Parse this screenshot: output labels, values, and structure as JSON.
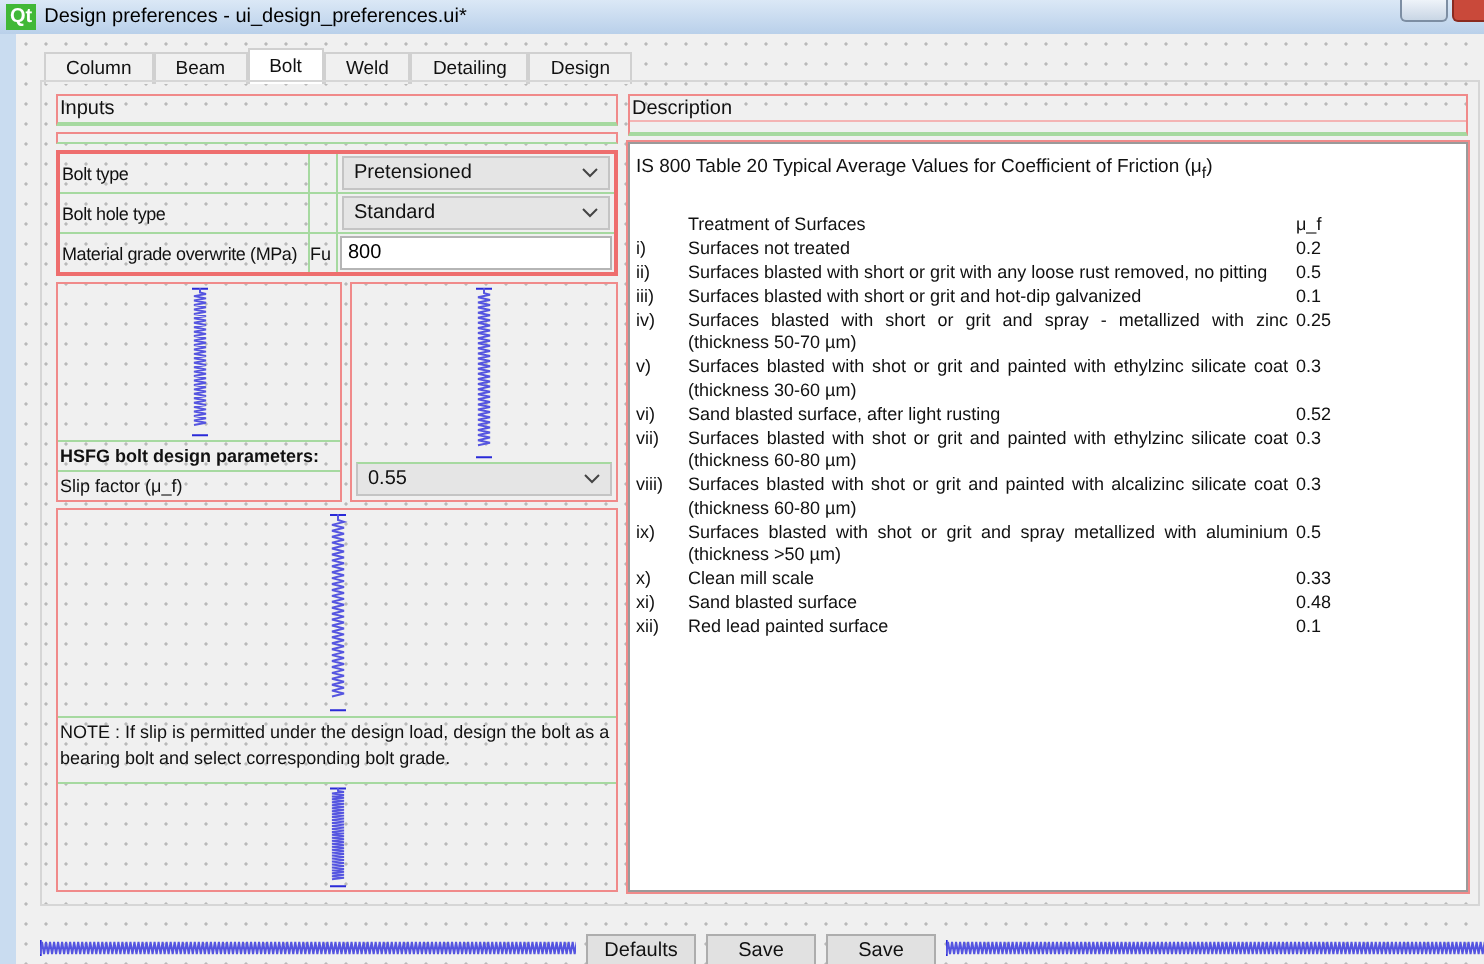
{
  "window": {
    "app_icon": "Qt",
    "title": "Design preferences - ui_design_preferences.ui*"
  },
  "tabs": [
    {
      "label": "Column",
      "selected": false
    },
    {
      "label": "Beam",
      "selected": false
    },
    {
      "label": "Bolt",
      "selected": true
    },
    {
      "label": "Weld",
      "selected": false
    },
    {
      "label": "Detailing",
      "selected": false
    },
    {
      "label": "Design",
      "selected": false
    }
  ],
  "inputs": {
    "title": "Inputs",
    "fields": [
      {
        "kind": "combo",
        "label": "Bolt type",
        "value": "Pretensioned"
      },
      {
        "kind": "combo",
        "label": "Bolt hole type",
        "value": "Standard"
      },
      {
        "kind": "text",
        "label": "Material grade overwrite (MPa)",
        "unit": "Fu",
        "value": "800"
      }
    ],
    "hsfg": {
      "heading": "HSFG bolt design parameters:",
      "label": "Slip factor (μ_f)",
      "value": "0.55"
    },
    "note": "NOTE : If slip is permitted under the design load, design the bolt as a bearing bolt and select corresponding bolt grade."
  },
  "description": {
    "title": "Description",
    "caption": "IS 800 Table 20 Typical Average Values for Coefficient of Friction (μ$_{f}$)",
    "header": [
      "Treatment of Surfaces",
      "μ_f"
    ],
    "rows": [
      {
        "numeral": "i)",
        "text": "Surfaces not treated",
        "value": "0.2"
      },
      {
        "numeral": "ii)",
        "text": "Surfaces blasted with short or grit with any loose rust removed, no pitting",
        "value": "0.5"
      },
      {
        "numeral": "iii)",
        "text": "Surfaces blasted with short or grit and hot-dip galvanized",
        "value": "0.1"
      },
      {
        "numeral": "iv)",
        "text": "Surfaces blasted with short or grit and spray - metallized with zinc (thickness 50-70 µm)",
        "value": "0.25"
      },
      {
        "numeral": "v)",
        "text": "Surfaces blasted with shot or grit and painted with ethylzinc silicate coat (thickness 30-60 µm)",
        "value": "0.3"
      },
      {
        "numeral": "vi)",
        "text": "Sand blasted surface, after light rusting",
        "value": "0.52"
      },
      {
        "numeral": "vii)",
        "text": "Surfaces blasted with shot or grit and painted with ethylzinc silicate coat (thickness 60-80 µm)",
        "value": "0.3"
      },
      {
        "numeral": "viii)",
        "text": "Surfaces blasted with shot or grit and painted with alcalizinc silicate coat (thickness 60-80 µm)",
        "value": "0.3"
      },
      {
        "numeral": "ix)",
        "text": "Surfaces blasted with shot or grit and spray metallized with aluminium (thickness >50 µm)",
        "value": "0.5"
      },
      {
        "numeral": "x)",
        "text": "Clean mill scale",
        "value": "0.33"
      },
      {
        "numeral": "xi)",
        "text": "Sand blasted surface",
        "value": "0.48"
      },
      {
        "numeral": "xii)",
        "text": "Red lead painted surface",
        "value": "0.1"
      }
    ]
  },
  "buttons": [
    "Defaults",
    "Save",
    "Save"
  ]
}
